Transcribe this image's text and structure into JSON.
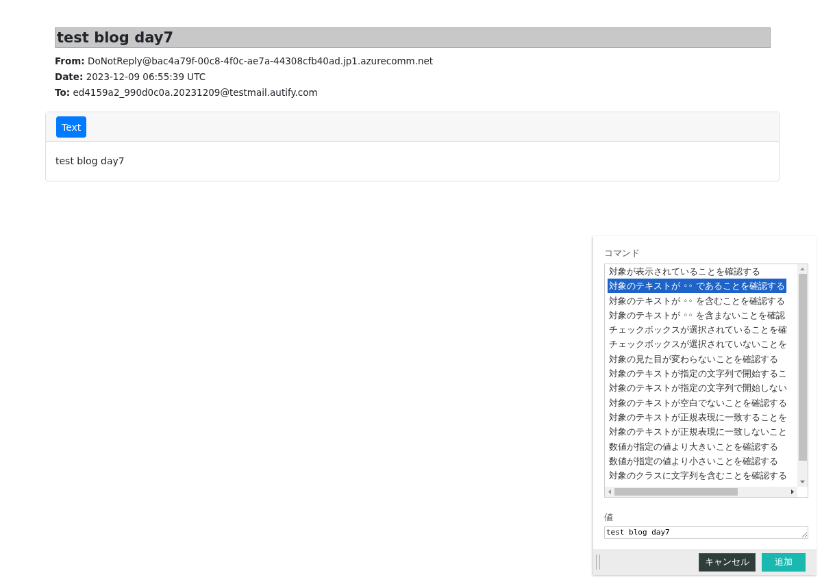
{
  "mail": {
    "subject": "test blog day7",
    "headers": [
      {
        "label": "From:",
        "value": "DoNotReply@bac4a79f-00c8-4f0c-ae7a-44308cfb40ad.jp1.azurecomm.net"
      },
      {
        "label": "Date:",
        "value": "2023-12-09 06:55:39 UTC"
      },
      {
        "label": "To:",
        "value": "ed4159a2_990d0c0a.20231209@testmail.autify.com"
      }
    ],
    "tabs": [
      {
        "label": "Text",
        "selected": true
      }
    ],
    "body": "test blog day7"
  },
  "panel": {
    "command_label": "コマンド",
    "commands": [
      {
        "label": "対象が表示されていることを確認する",
        "selected": false
      },
      {
        "label": "対象のテキストが ◦◦ であることを確認する",
        "selected": true
      },
      {
        "label": "対象のテキストが ◦◦ を含むことを確認する",
        "selected": false
      },
      {
        "label": "対象のテキストが ◦◦ を含まないことを確認",
        "selected": false
      },
      {
        "label": "チェックボックスが選択されていることを確",
        "selected": false
      },
      {
        "label": "チェックボックスが選択されていないことを",
        "selected": false
      },
      {
        "label": "対象の見た目が変わらないことを確認する",
        "selected": false
      },
      {
        "label": "対象のテキストが指定の文字列で開始するこ",
        "selected": false
      },
      {
        "label": "対象のテキストが指定の文字列で開始しない",
        "selected": false
      },
      {
        "label": "対象のテキストが空白でないことを確認する",
        "selected": false
      },
      {
        "label": "対象のテキストが正規表現に一致することを",
        "selected": false
      },
      {
        "label": "対象のテキストが正規表現に一致しないこと",
        "selected": false
      },
      {
        "label": "数値が指定の値より大きいことを確認する",
        "selected": false
      },
      {
        "label": "数値が指定の値より小さいことを確認する",
        "selected": false
      },
      {
        "label": "対象のクラスに文字列を含むことを確認する",
        "selected": false
      }
    ],
    "value_label": "値",
    "value": "test blog day7",
    "buttons": [
      {
        "label": "キャンセル",
        "kind": "cancel"
      },
      {
        "label": "追加",
        "kind": "add"
      }
    ]
  }
}
